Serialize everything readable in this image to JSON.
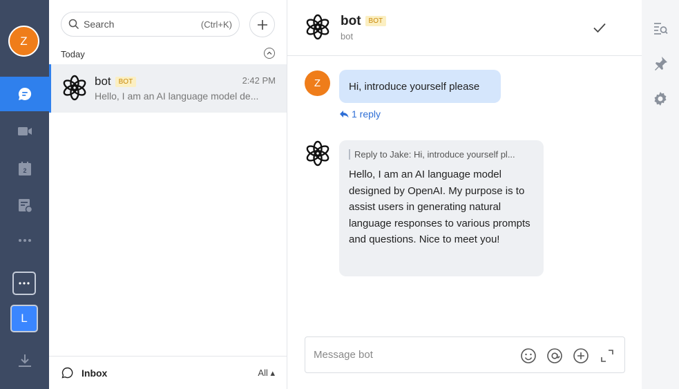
{
  "rail": {
    "avatar_initial": "Z",
    "nav": [
      "chat-icon",
      "video-icon",
      "calendar-icon",
      "tasks-icon",
      "more-icon"
    ],
    "calendar_day": "2",
    "workspace_initial": "L"
  },
  "list": {
    "search_placeholder": "Search",
    "search_shortcut": "(Ctrl+K)",
    "section": "Today",
    "conversations": [
      {
        "name": "bot",
        "badge": "BOT",
        "time": "2:42 PM",
        "preview": "Hello, I am an AI language model de..."
      }
    ],
    "footer_label": "Inbox",
    "footer_filter": "All ▴"
  },
  "chat": {
    "title": "bot",
    "badge": "BOT",
    "subtitle": "bot",
    "user_avatar_initial": "Z",
    "user_message": "Hi, introduce yourself please",
    "reply_count": "1 reply",
    "bot_quote": "Reply to Jake:  Hi, introduce yourself pl...",
    "bot_message": "Hello, I am an AI language model designed by OpenAI. My purpose is to assist users in generating natural language responses to various prompts and questions. Nice to meet you!",
    "composer_placeholder": "Message bot"
  },
  "colors": {
    "rail_bg": "#3d4a63",
    "accent": "#2f80ed",
    "avatar_orange": "#ef7d1a",
    "user_bubble": "#d5e6fc",
    "bot_bubble": "#eef0f3",
    "badge_bg": "#fbefc2",
    "badge_text": "#c9890a"
  }
}
